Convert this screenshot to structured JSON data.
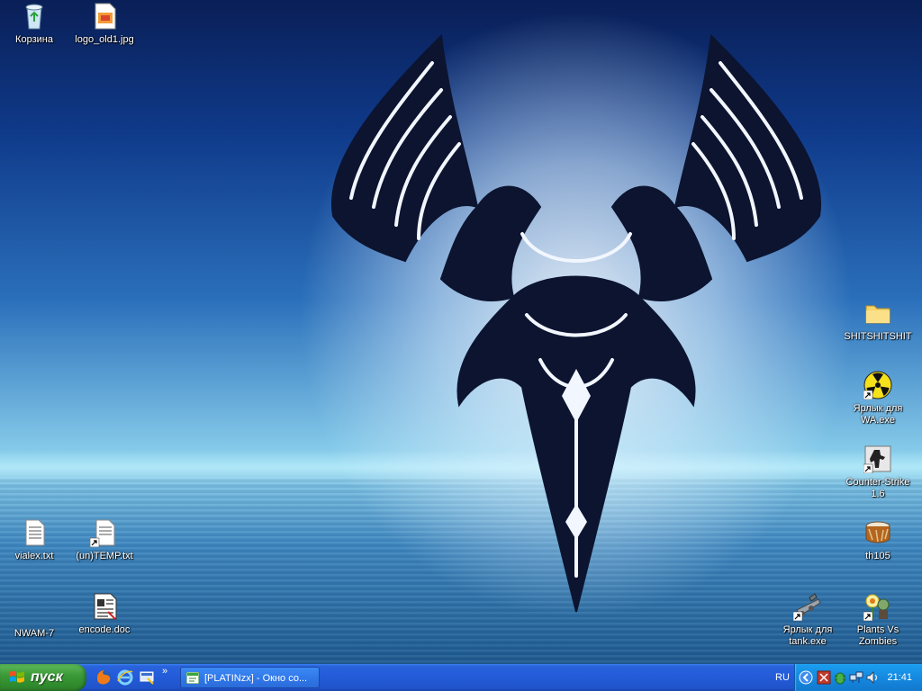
{
  "desktop": {
    "icons": [
      {
        "label": "Корзина"
      },
      {
        "label": "logo_old1.jpg"
      },
      {
        "label": "SHITSHITSHIT"
      },
      {
        "label": "Ярлык для WA.exe"
      },
      {
        "label": "Counter-Strike 1.6"
      },
      {
        "label": "th105"
      },
      {
        "label": "vialex.txt"
      },
      {
        "label": "(un)TEMP.txt"
      },
      {
        "label": "NWAM-7"
      },
      {
        "label": "encode.doc"
      },
      {
        "label": "Ярлык для tank.exe"
      },
      {
        "label": "Plants Vs Zombies"
      }
    ]
  },
  "taskbar": {
    "start_label": "пуск",
    "quick_launch_chevron": "»",
    "task_button_label": "[PLATINzx] - Окно со...",
    "language": "RU",
    "clock": "21:41"
  },
  "colors": {
    "taskbar_blue": "#245ddb",
    "start_green": "#3c9a38",
    "tray_blue": "#1589e0"
  }
}
